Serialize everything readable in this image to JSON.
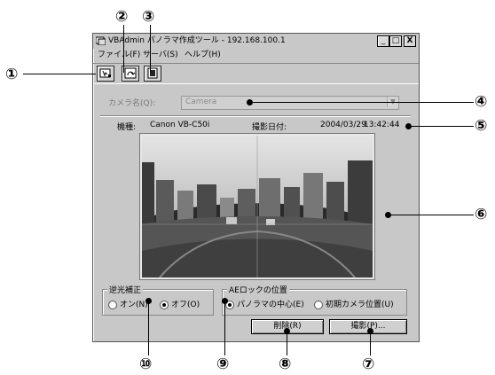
{
  "callouts": [
    "①",
    "②",
    "③",
    "④",
    "⑤",
    "⑥",
    "⑦",
    "⑧",
    "⑨",
    "⑩"
  ],
  "window": {
    "title": "VBAdmin パノラマ作成ツール - 192.168.100.1",
    "min_glyph": "_",
    "max_glyph": "□",
    "close_glyph": "X"
  },
  "menu": [
    "ファイル(F)",
    "サーバ(S)",
    "ヘルプ(H)"
  ],
  "toolbar_icons": [
    "capture-icon",
    "connect-icon",
    "document-icon"
  ],
  "camera": {
    "label": "カメラ名(Q):",
    "value": "Camera"
  },
  "info": {
    "model_label": "機種:",
    "model_value": "Canon VB-C50i",
    "date_label": "撮影日付:",
    "date_value": "2004/03/29",
    "time_value": "13:42:44"
  },
  "backlight": {
    "title": "逆光補正",
    "options": [
      "オン(N)",
      "オフ(O)"
    ],
    "selected": 1
  },
  "ae_lock": {
    "title": "AEロックの位置",
    "options": [
      "パノラマの中心(E)",
      "初期カメラ位置(U)"
    ],
    "selected": 0
  },
  "buttons": {
    "delete": "削除(R)",
    "capture": "撮影(P)..."
  }
}
